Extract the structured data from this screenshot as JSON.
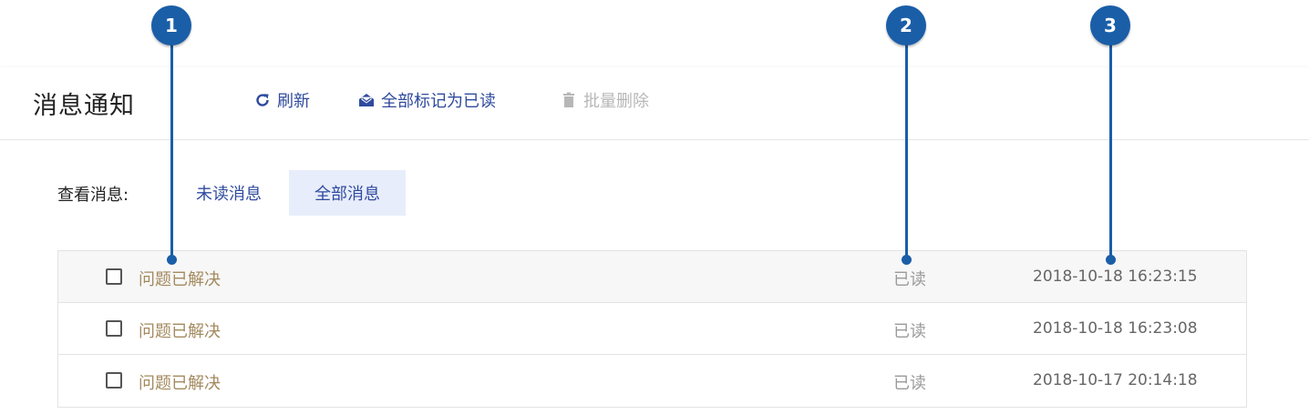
{
  "header": {
    "title": "消息通知",
    "toolbar": {
      "refresh_label": "刷新",
      "mark_all_read_label": "全部标记为已读",
      "batch_delete_label": "批量删除"
    }
  },
  "filter": {
    "label": "查看消息:",
    "tabs": [
      {
        "label": "未读消息",
        "active": false
      },
      {
        "label": "全部消息",
        "active": true
      }
    ]
  },
  "messages": [
    {
      "title": "问题已解决",
      "status": "已读",
      "time": "2018-10-18 16:23:15"
    },
    {
      "title": "问题已解决",
      "status": "已读",
      "time": "2018-10-18 16:23:08"
    },
    {
      "title": "问题已解决",
      "status": "已读",
      "time": "2018-10-17 20:14:18"
    }
  ],
  "callouts": [
    "1",
    "2",
    "3"
  ],
  "colors": {
    "accent": "#2f4a9e",
    "callout": "#1a5ea8",
    "active_tab_bg": "#e8edfb",
    "disabled": "#b7b7b7",
    "message_title": "#a38a5e"
  },
  "icons": {
    "refresh": "refresh-icon",
    "mark_read": "envelope-open-icon",
    "delete": "trash-icon"
  }
}
